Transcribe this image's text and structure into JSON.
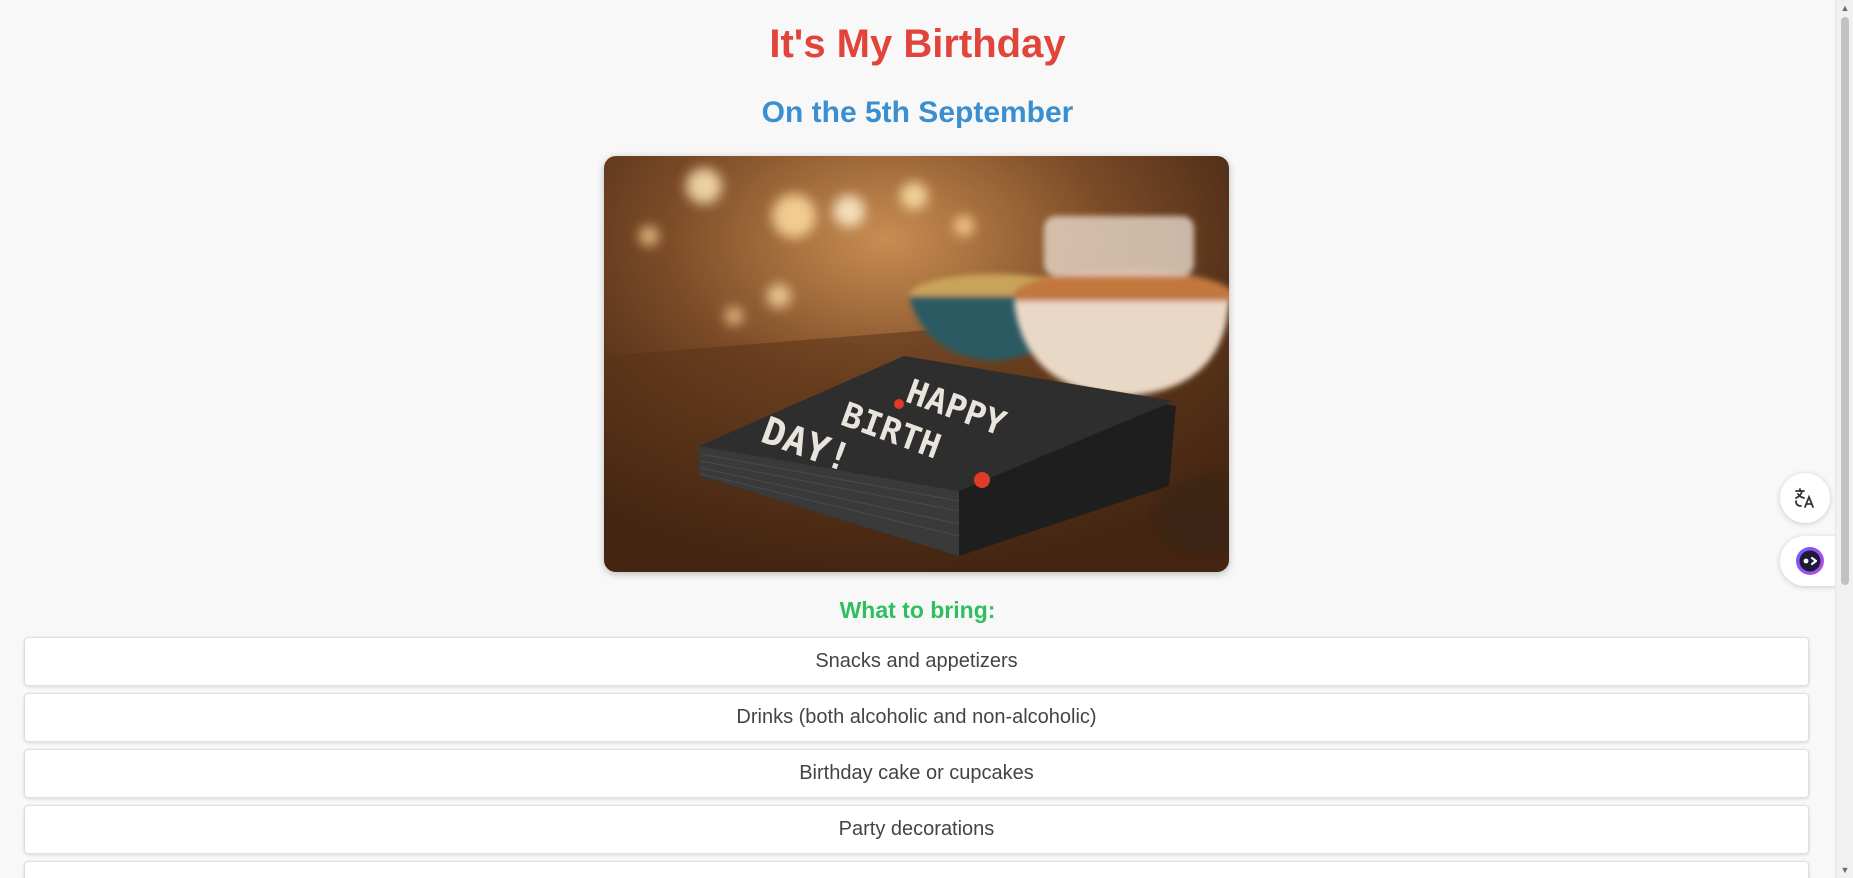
{
  "header": {
    "title": "It's My Birthday",
    "subtitle": "On the 5th September"
  },
  "photo": {
    "napkin_text_line1": "HAPPY",
    "napkin_text_line2": "BIRTH",
    "napkin_text_line3": "DAY!"
  },
  "bring": {
    "heading": "What to bring:",
    "items": [
      "Snacks and appetizers",
      "Drinks (both alcoholic and non-alcoholic)",
      "Birthday cake or cupcakes",
      "Party decorations"
    ]
  },
  "icons": {
    "translate": "translate-icon",
    "assistant": "assistant-icon",
    "scroll_up": "arrow-up-icon",
    "scroll_down": "arrow-down-icon"
  },
  "colors": {
    "title": "#e0443a",
    "subtitle": "#3a8fd0",
    "heading": "#2fbf5f"
  }
}
